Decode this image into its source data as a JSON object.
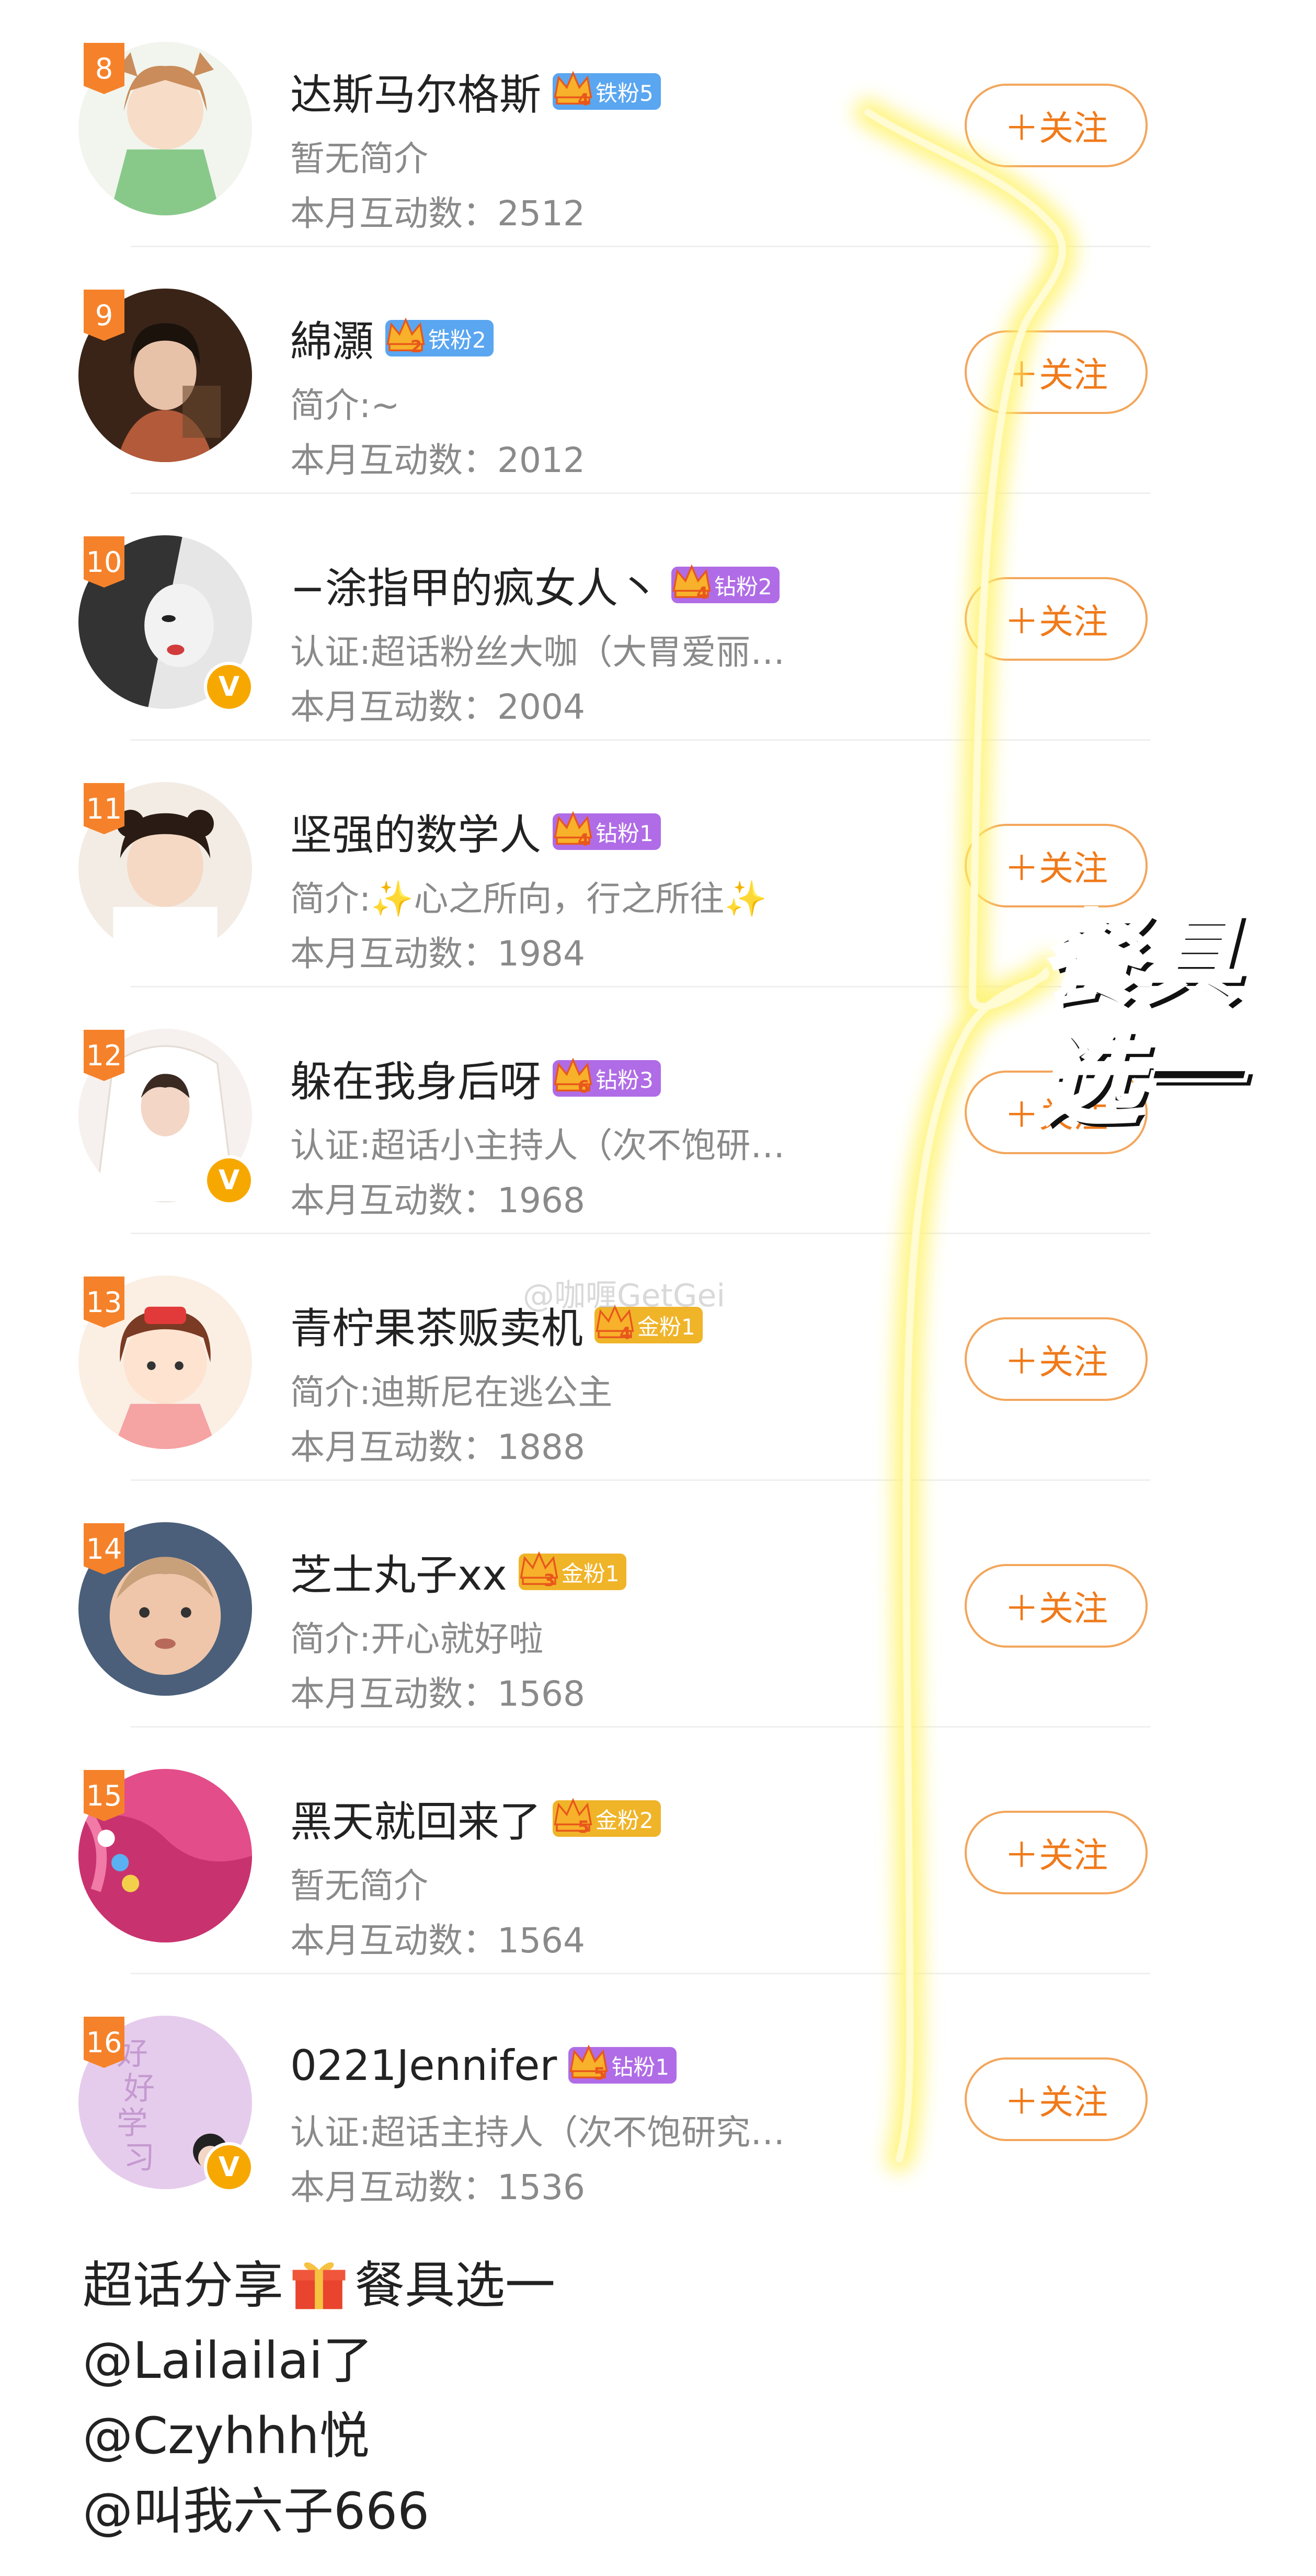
{
  "label_count_prefix": "本月互动数：",
  "follow_label": "＋关注",
  "users": [
    {
      "rank": "8",
      "name": "达斯马尔格斯",
      "fan_level": "4",
      "fan_badge": "铁粉5",
      "fan_color": "#5aa6f0",
      "desc": "暂无简介",
      "count": "2512",
      "verified": false,
      "avatar": "anime-girl-avatar"
    },
    {
      "rank": "9",
      "name": "綿灝",
      "fan_level": "2",
      "fan_badge": "铁粉2",
      "fan_color": "#5aa6f0",
      "desc": "简介:~",
      "count": "2012",
      "verified": false,
      "avatar": "woman-portrait-avatar"
    },
    {
      "rank": "10",
      "name": "−涂指甲的疯女人丶",
      "fan_level": "4",
      "fan_badge": "钻粉2",
      "fan_color": "#b06ce6",
      "desc": "认证:超话粉丝大咖（大胃爱丽…",
      "count": "2004",
      "verified": true,
      "avatar": "bw-woman-avatar"
    },
    {
      "rank": "11",
      "name": "坚强的数学人",
      "fan_level": "4",
      "fan_badge": "钻粉1",
      "fan_color": "#b06ce6",
      "desc": "简介:✨心之所向，行之所往✨",
      "count": "1984",
      "verified": false,
      "avatar": "child-avatar"
    },
    {
      "rank": "12",
      "name": "躲在我身后呀",
      "fan_level": "6",
      "fan_badge": "钻粉3",
      "fan_color": "#b06ce6",
      "desc": "认证:超话小主持人（次不饱研…",
      "count": "1968",
      "verified": true,
      "avatar": "bride-avatar"
    },
    {
      "rank": "13",
      "name": "青柠果茶贩卖机",
      "fan_level": "4",
      "fan_badge": "金粉1",
      "fan_color": "#f0b429",
      "desc": "简介:迪斯尼在逃公主",
      "count": "1888",
      "verified": false,
      "avatar": "cartoon-girl-avatar"
    },
    {
      "rank": "14",
      "name": "芝士丸子xx",
      "fan_level": "3",
      "fan_badge": "金粉1",
      "fan_color": "#f0b429",
      "desc": "简介:开心就好啦",
      "count": "1568",
      "verified": false,
      "avatar": "baby-avatar"
    },
    {
      "rank": "15",
      "name": "黑天就回来了",
      "fan_level": "5",
      "fan_badge": "金粉2",
      "fan_color": "#f0b429",
      "desc": "暂无简介",
      "count": "1564",
      "verified": false,
      "avatar": "pink-fabric-avatar"
    },
    {
      "rank": "16",
      "name": "0221Jennifer",
      "fan_level": "5",
      "fan_badge": "钻粉1",
      "fan_color": "#b06ce6",
      "desc": "认证:超话主持人（次不饱研究…",
      "count": "1536",
      "verified": true,
      "avatar": "study-text-avatar"
    }
  ],
  "overlay_text": [
    "餐具",
    "选一"
  ],
  "watermark": "@咖喱GetGei",
  "avatar16_text": [
    "好",
    "好",
    "学",
    "习"
  ],
  "caption": {
    "line1_a": "超话分享",
    "line1_b": "餐具选一",
    "line2": "@Lailailai了",
    "line3": "@Czyhhh悦",
    "line4": "@叫我六子666"
  }
}
